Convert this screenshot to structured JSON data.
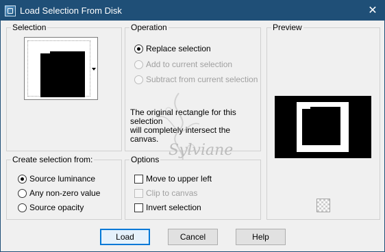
{
  "window": {
    "title": "Load Selection From Disk",
    "close_glyph": "✕"
  },
  "selection": {
    "group_label": "Selection"
  },
  "operation": {
    "group_label": "Operation",
    "options": [
      {
        "label": "Replace selection",
        "checked": true,
        "disabled": false
      },
      {
        "label": "Add to current selection",
        "checked": false,
        "disabled": true
      },
      {
        "label": "Subtract from current selection",
        "checked": false,
        "disabled": true
      }
    ],
    "info_line1": "The original rectangle for this selection",
    "info_line2": "will completely intersect the canvas."
  },
  "preview": {
    "group_label": "Preview"
  },
  "create_from": {
    "group_label": "Create selection from:",
    "options": [
      {
        "label": "Source luminance",
        "checked": true
      },
      {
        "label": "Any non-zero value",
        "checked": false
      },
      {
        "label": "Source opacity",
        "checked": false
      }
    ]
  },
  "options": {
    "group_label": "Options",
    "items": [
      {
        "label": "Move to upper left",
        "checked": false,
        "disabled": false
      },
      {
        "label": "Clip to canvas",
        "checked": false,
        "disabled": true
      },
      {
        "label": "Invert selection",
        "checked": false,
        "disabled": false
      }
    ]
  },
  "watermark": {
    "text": "Sylviane"
  },
  "buttons": {
    "load": "Load",
    "cancel": "Cancel",
    "help": "Help"
  }
}
